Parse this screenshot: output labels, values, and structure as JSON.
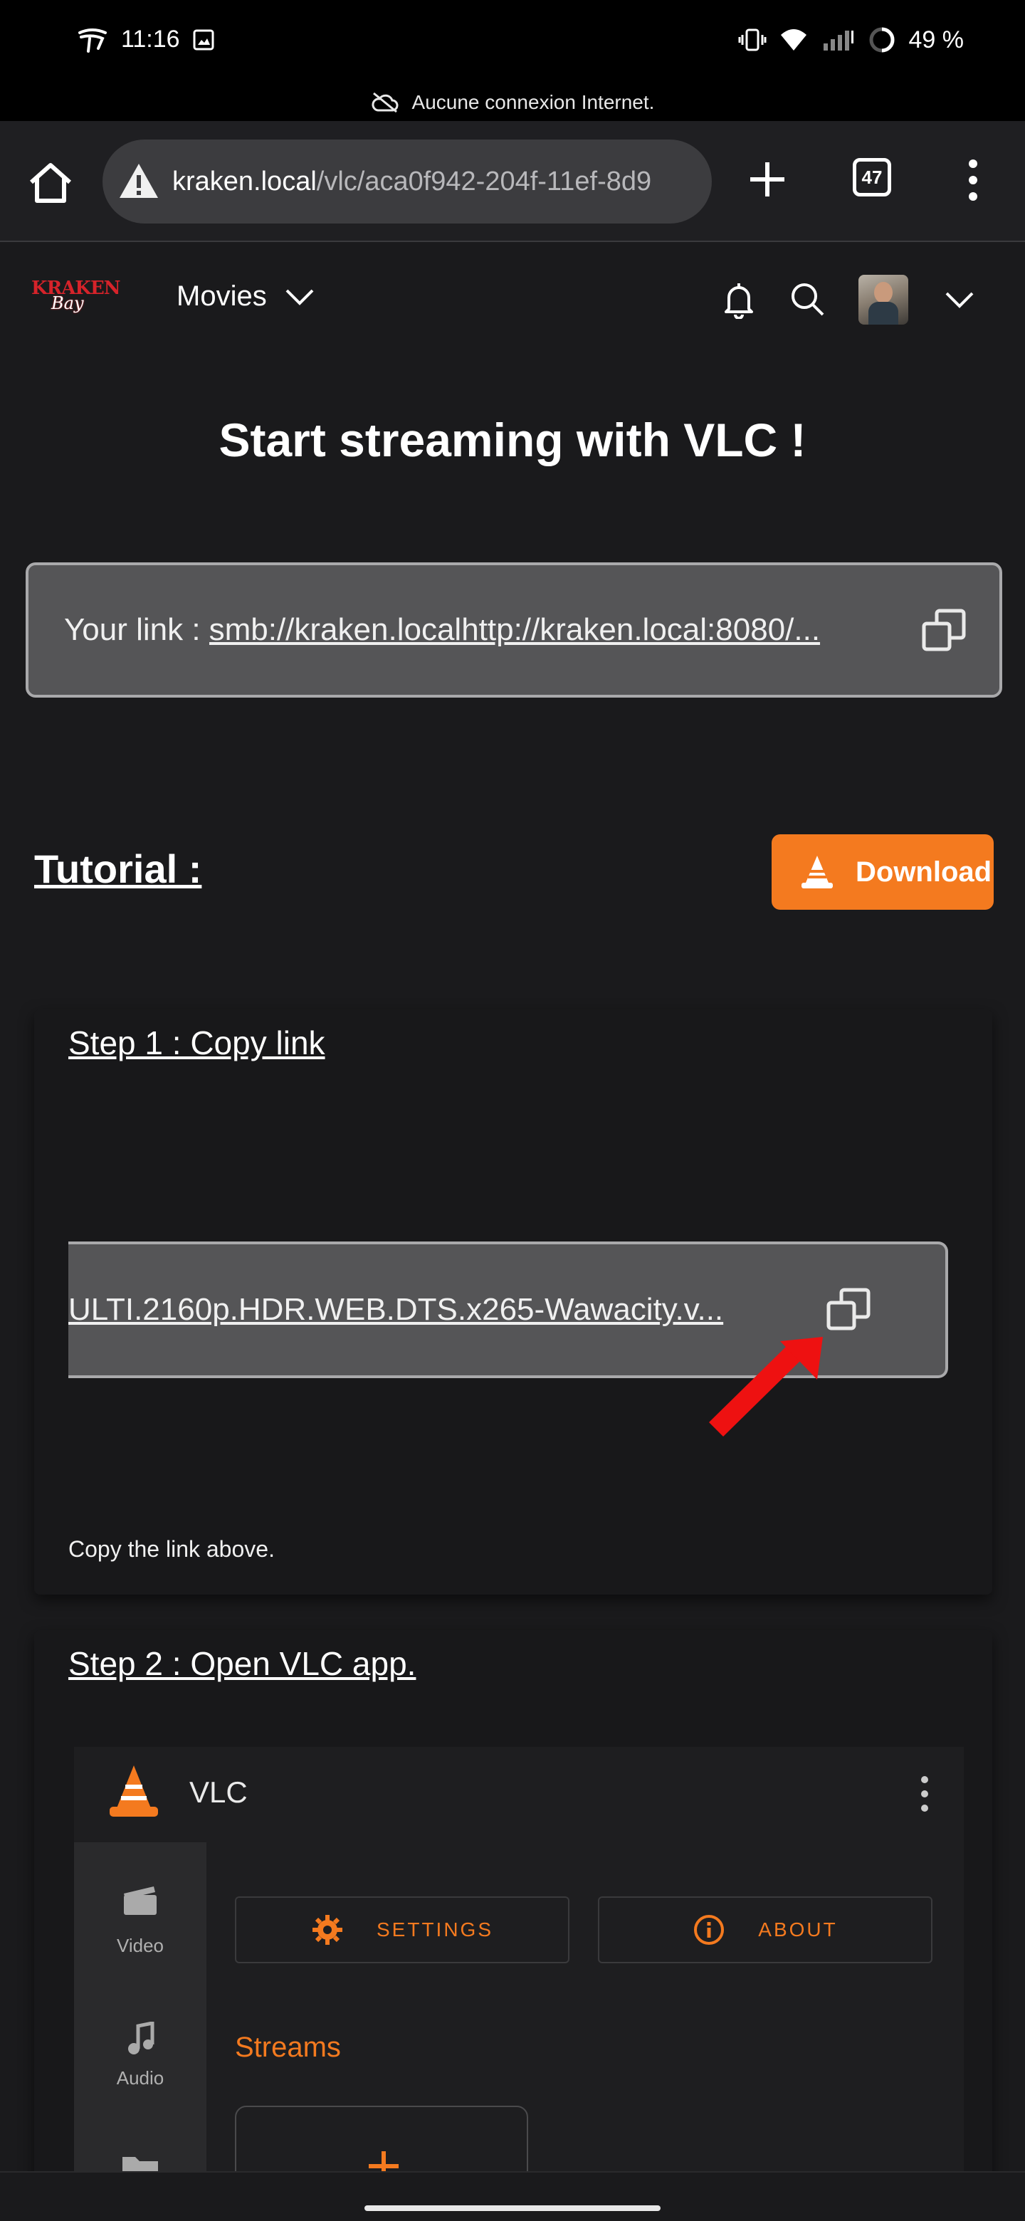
{
  "status_bar": {
    "time": "11:16",
    "battery": "49 %",
    "offline_message": "Aucune connexion Internet."
  },
  "browser": {
    "url_host": "kraken.local",
    "url_path": "/vlc/aca0f942-204f-11ef-8d9",
    "tab_count": "47",
    "icons": [
      "home-icon",
      "warning-icon",
      "plus-icon",
      "tabs-icon",
      "more-vert-icon"
    ]
  },
  "site": {
    "logo_top": "KRAKEN",
    "logo_bottom": "Bay",
    "nav_label": "Movies",
    "accent_color": "#f47a1f",
    "brand_color": "#d6232a"
  },
  "main": {
    "title": "Start streaming with VLC !",
    "link_label": "Your link :",
    "link_url": "smb://kraken.localhttp://kraken.local:8080/...",
    "tutorial_title": "Tutorial :",
    "download_label": "Download"
  },
  "steps": [
    {
      "title": "Step 1 : Copy link",
      "link_excerpt": "ULTI.2160p.HDR.WEB.DTS.x265-Wawacity.v...",
      "description": "Copy the link above."
    },
    {
      "title": "Step 2 : Open VLC app."
    }
  ],
  "vlc": {
    "app_name": "VLC",
    "side_items": [
      "Video",
      "Audio"
    ],
    "settings_label": "SETTINGS",
    "about_label": "ABOUT",
    "streams_label": "Streams"
  }
}
